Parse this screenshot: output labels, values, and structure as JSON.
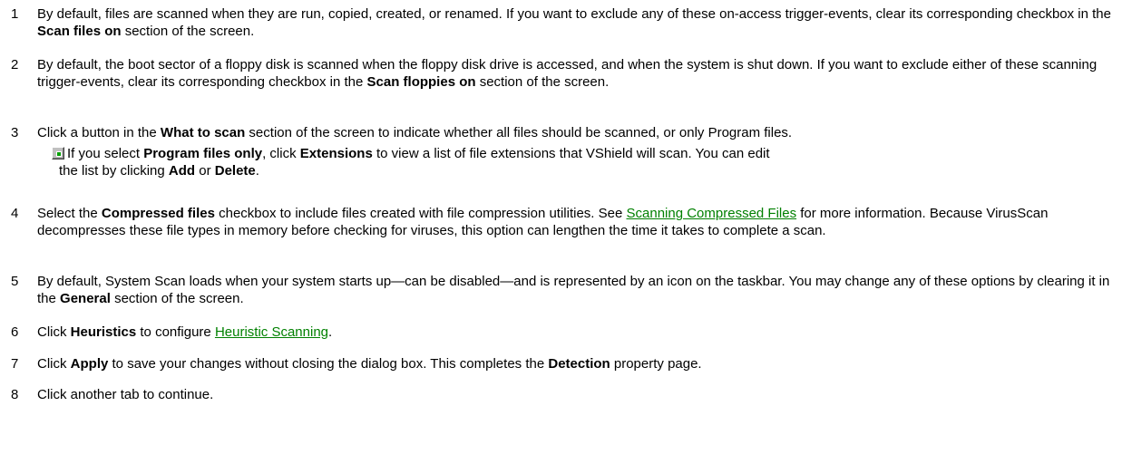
{
  "steps": [
    {
      "num": "1",
      "p1": "By default, files are scanned when they are run, copied, created, or renamed. If you want to exclude any of these on-access trigger-events, clear its corresponding checkbox in the ",
      "b1": "Scan files on",
      "p2": " section of the screen."
    },
    {
      "num": "2",
      "p1": "By default, the boot sector of a floppy disk is scanned when the floppy disk drive is accessed, and when the system is shut down. If you want to exclude either of these scanning trigger-events, clear its corresponding checkbox in the ",
      "b1": "Scan floppies on",
      "p2": " section of the screen."
    },
    {
      "num": "3",
      "p1": "Click a button in the ",
      "b1": "What to scan",
      "p2": " section of the screen to indicate whether all files should be scanned, or only Program files.",
      "note": {
        "icon": "note-icon",
        "p1": "If you select ",
        "b1": "Program files only",
        "p2": ", click ",
        "b2": "Extensions",
        "p3": " to view a list of file extensions that VShield will scan. You can edit",
        "p4": "the list by clicking ",
        "b3": "Add",
        "p5": " or ",
        "b4": "Delete",
        "p6": "."
      }
    },
    {
      "num": "4",
      "p1": "Select the ",
      "b1": "Compressed files",
      "p2": " checkbox to include files created with file compression utilities. See ",
      "link1": "Scanning Compressed Files",
      "p3": " for more information. Because VirusScan decompresses these file types in memory before checking for viruses, this option can lengthen the time it takes to complete a scan."
    },
    {
      "num": "5",
      "p1": "By default, System Scan loads when your system starts up—can be disabled—and is represented by an icon on the taskbar. You may change any of these options by clearing it in the ",
      "b1": "General",
      "p2": " section of the screen."
    },
    {
      "num": "6",
      "p1": "Click ",
      "b1": "Heuristics",
      "p2": " to configure ",
      "link1": "Heuristic Scanning",
      "p3": "."
    },
    {
      "num": "7",
      "p1": "Click ",
      "b1": "Apply",
      "p2": " to save your changes without closing the dialog box. This completes the ",
      "b2": "Detection",
      "p3": " property page."
    },
    {
      "num": "8",
      "p1": "Click another tab to continue."
    }
  ],
  "colors": {
    "link": "#008000",
    "text": "#000000",
    "background": "#ffffff"
  }
}
